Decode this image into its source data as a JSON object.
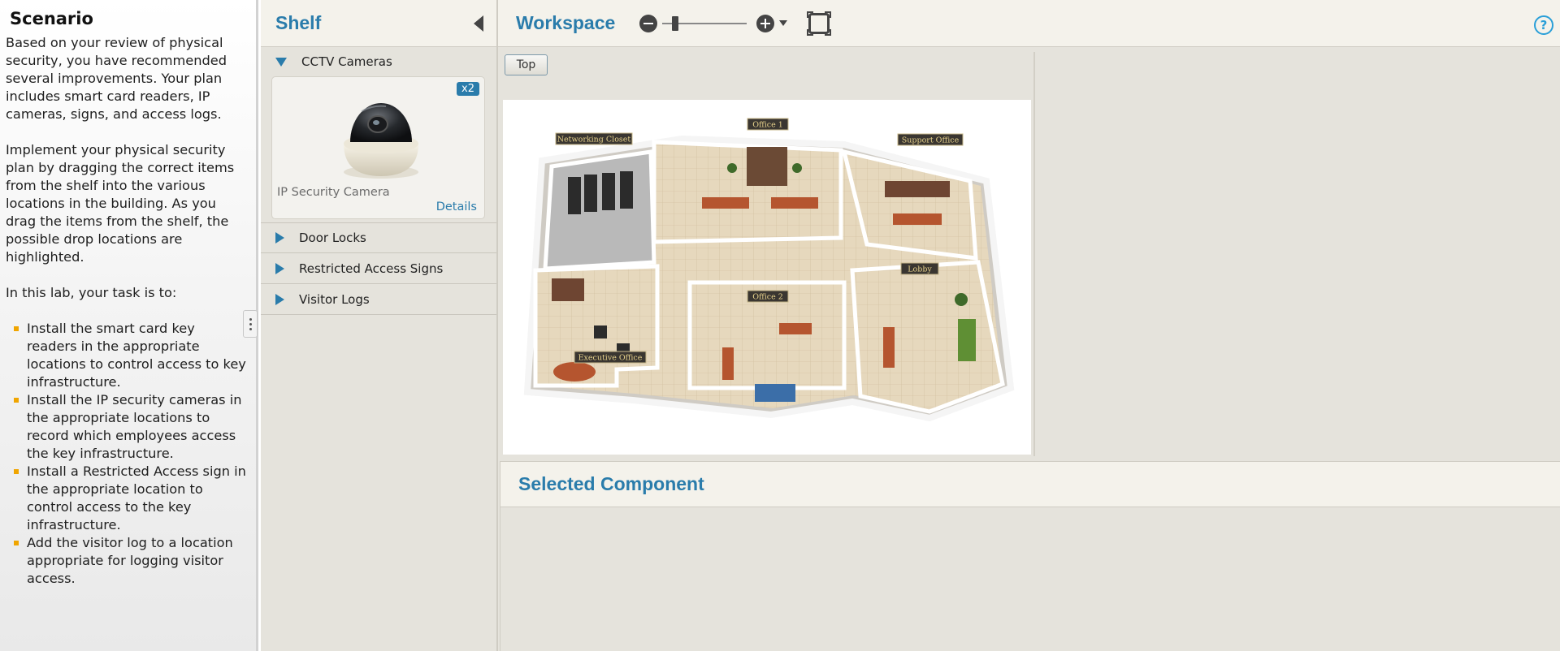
{
  "scenario": {
    "title": "Scenario",
    "para1": "Based on your review of physical security, you have recommended several improvements. Your plan includes smart card readers, IP cameras, signs, and access logs.",
    "para2": "Implement your physical security plan by dragging the correct items from the shelf into the various locations in the building. As you drag the items from the shelf, the possible drop locations are highlighted.",
    "para3": "In this lab, your task is to:",
    "tasks": [
      "Install the smart card key readers in the appropriate locations to control access to key infrastructure.",
      "Install the IP security cameras in the appropriate locations to record which employees access the key infrastructure.",
      "Install a Restricted Access sign in the appropriate location to control access to the key infrastructure.",
      "Add the visitor log to a location appropriate for logging visitor access."
    ]
  },
  "shelf": {
    "title": "Shelf",
    "categories": [
      {
        "label": "CCTV Cameras",
        "expanded": true
      },
      {
        "label": "Door Locks",
        "expanded": false
      },
      {
        "label": "Restricted Access Signs",
        "expanded": false
      },
      {
        "label": "Visitor Logs",
        "expanded": false
      }
    ],
    "item": {
      "name": "IP Security Camera",
      "quantity": "x2",
      "details_label": "Details"
    }
  },
  "workspace": {
    "title": "Workspace",
    "top_button": "Top",
    "help": "?",
    "rooms": {
      "networking_closet": "Networking Closet",
      "office1": "Office 1",
      "support_office": "Support Office",
      "lobby": "Lobby",
      "office2": "Office 2",
      "executive_office": "Executive Office"
    }
  },
  "selected_component": {
    "title": "Selected Component"
  },
  "colors": {
    "accent": "#2a7cab",
    "bullet": "#f0a500",
    "panel": "#e5e3dc"
  }
}
